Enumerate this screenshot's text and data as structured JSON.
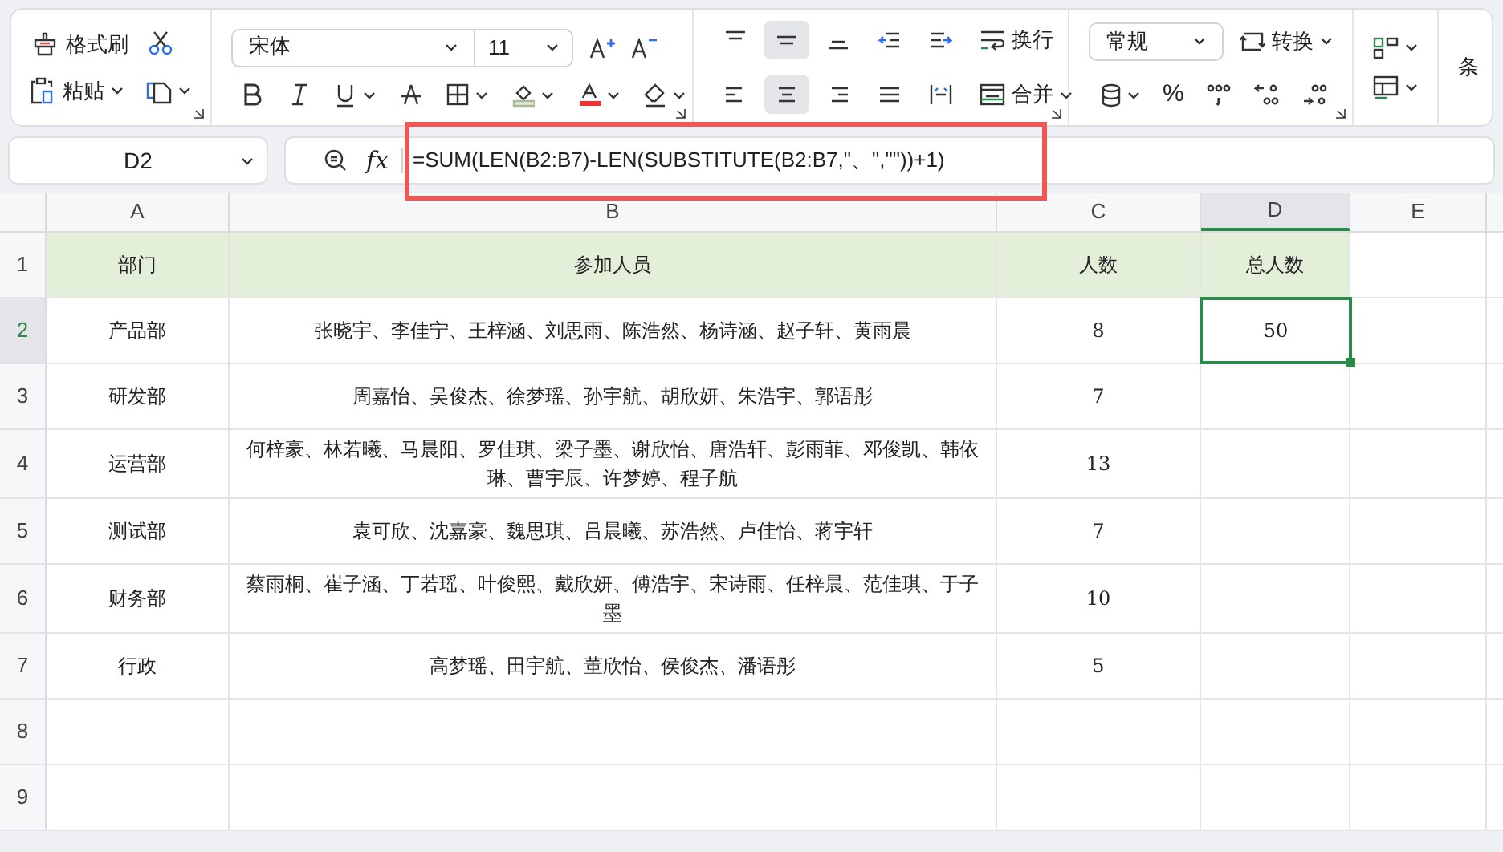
{
  "ribbon": {
    "clipboard": {
      "format_painter": "格式刷",
      "paste": "粘贴"
    },
    "font": {
      "name": "宋体",
      "size": "11"
    },
    "alignment": {
      "wrap": "换行",
      "merge": "合并",
      "top_buttons": [
        {
          "kind": "top",
          "selected": false
        },
        {
          "kind": "middle",
          "selected": true
        },
        {
          "kind": "bottom",
          "selected": false
        },
        {
          "kind": "outdent",
          "selected": false
        },
        {
          "kind": "indent",
          "selected": false
        }
      ],
      "bottom_buttons": [
        {
          "kind": "left",
          "selected": false
        },
        {
          "kind": "center",
          "selected": true
        },
        {
          "kind": "right",
          "selected": false
        },
        {
          "kind": "justify",
          "selected": false
        },
        {
          "kind": "distribute",
          "selected": false
        }
      ]
    },
    "number": {
      "format": "常规",
      "convert": "转换",
      "percent": "%"
    },
    "conditional": "条"
  },
  "formula_bar": {
    "cell_ref": "D2",
    "function_label": "fx",
    "formula": "=SUM(LEN(B2:B7)-LEN(SUBSTITUTE(B2:B7,\"、\",\"\"))+1)",
    "highlighted": true
  },
  "sheet": {
    "columns": [
      {
        "label": "A",
        "selected": false
      },
      {
        "label": "B",
        "selected": false
      },
      {
        "label": "C",
        "selected": false
      },
      {
        "label": "D",
        "selected": true
      },
      {
        "label": "E",
        "selected": false
      }
    ],
    "rows": [
      {
        "number": "1",
        "selected": false,
        "header": true,
        "cells": [
          "部门",
          "参加人员",
          "人数",
          "总人数"
        ]
      },
      {
        "number": "2",
        "selected": true,
        "header": false,
        "cells": [
          "产品部",
          "张晓宇、李佳宁、王梓涵、刘思雨、陈浩然、杨诗涵、赵子轩、黄雨晨",
          "8",
          "50"
        ]
      },
      {
        "number": "3",
        "selected": false,
        "header": false,
        "cells": [
          "研发部",
          "周嘉怡、吴俊杰、徐梦瑶、孙宇航、胡欣妍、朱浩宇、郭语彤",
          "7"
        ]
      },
      {
        "number": "4",
        "selected": false,
        "header": false,
        "cells": [
          "运营部",
          "何梓豪、林若曦、马晨阳、罗佳琪、梁子墨、谢欣怡、唐浩轩、彭雨菲、邓俊凯、韩依琳、曹宇辰、许梦婷、程子航",
          "13"
        ]
      },
      {
        "number": "5",
        "selected": false,
        "header": false,
        "cells": [
          "测试部",
          "袁可欣、沈嘉豪、魏思琪、吕晨曦、苏浩然、卢佳怡、蒋宇轩",
          "7"
        ]
      },
      {
        "number": "6",
        "selected": false,
        "header": false,
        "cells": [
          "财务部",
          "蔡雨桐、崔子涵、丁若瑶、叶俊熙、戴欣妍、傅浩宇、宋诗雨、任梓晨、范佳琪、于子墨",
          "10"
        ]
      },
      {
        "number": "7",
        "selected": false,
        "header": false,
        "cells": [
          "行政",
          "高梦瑶、田宇航、董欣怡、侯俊杰、潘语彤",
          "5"
        ]
      },
      {
        "number": "8",
        "selected": false
      },
      {
        "number": "9",
        "selected": false
      }
    ]
  }
}
